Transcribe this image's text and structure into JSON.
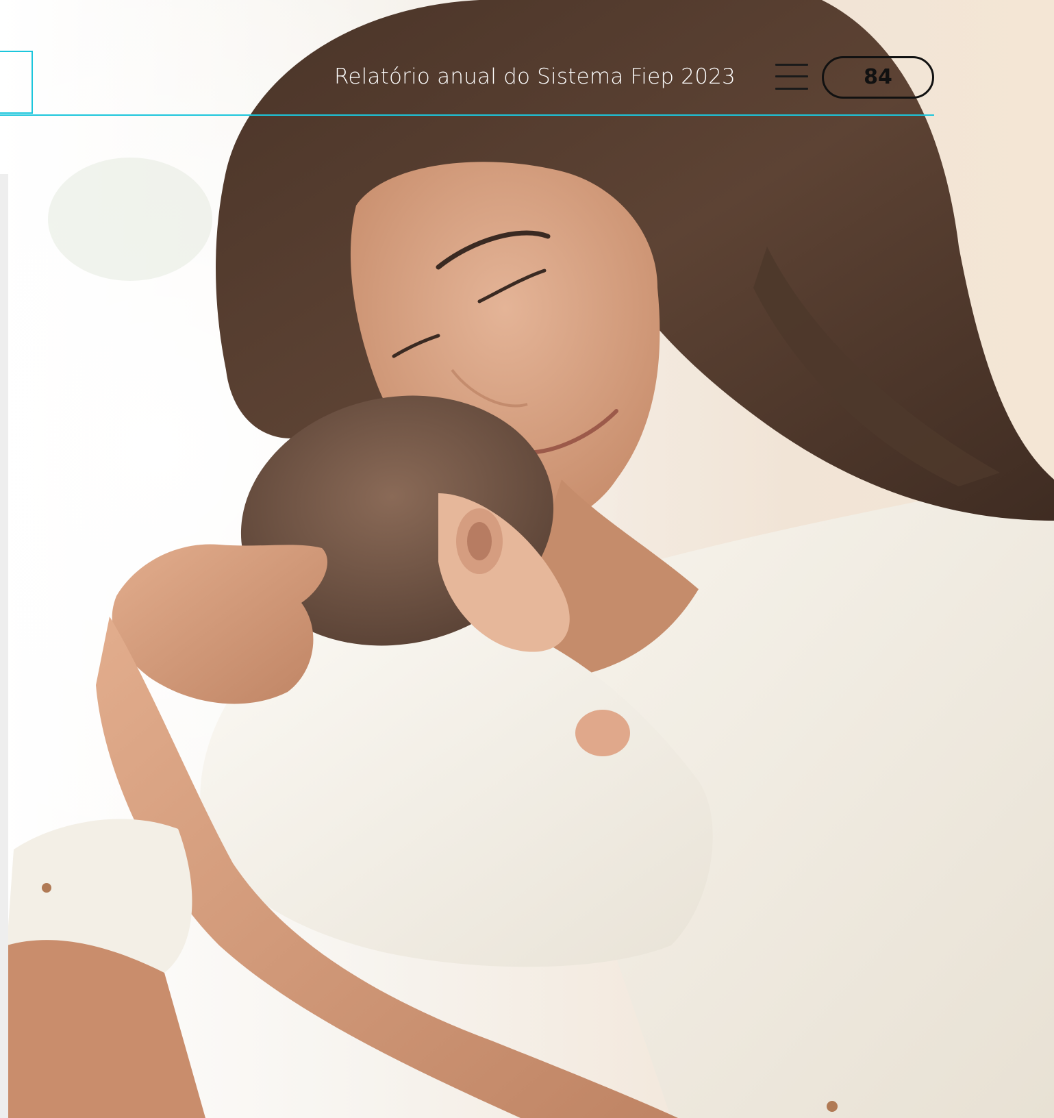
{
  "header": {
    "report_title": "Relatório anual do Sistema Fiep 2023",
    "page_number": "84",
    "menu_icon": "hamburger-menu-icon",
    "accent_color": "#1cc6dc"
  },
  "photo": {
    "subject": "mother-holding-newborn"
  }
}
